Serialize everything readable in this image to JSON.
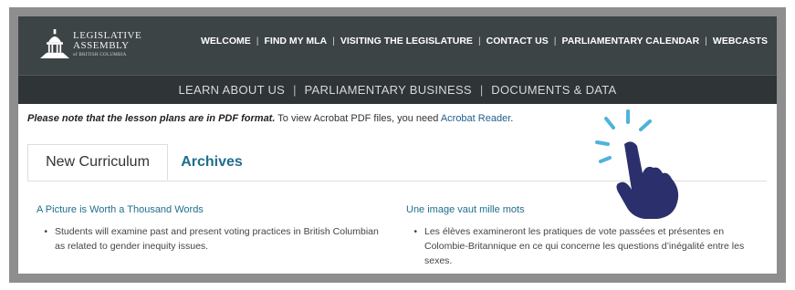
{
  "logo": {
    "name": "LEGISLATIVE ASSEMBLY",
    "sub": "of BRITISH COLUMBIA"
  },
  "top_nav": {
    "items": [
      "WELCOME",
      "FIND MY MLA",
      "VISITING THE LEGISLATURE",
      "CONTACT US",
      "PARLIAMENTARY CALENDAR",
      "WEBCASTS"
    ],
    "separator": "|"
  },
  "main_nav": {
    "items": [
      "LEARN ABOUT US",
      "PARLIAMENTARY BUSINESS",
      "DOCUMENTS & DATA"
    ],
    "separator": "|"
  },
  "notice": {
    "emphasis": "Please note that the lesson plans are in PDF format.",
    "text": " To view Acrobat PDF files, you need ",
    "link": "Acrobat Reader",
    "end": "."
  },
  "tabs": {
    "active": "New Curriculum",
    "inactive": "Archives"
  },
  "lessons": {
    "english": {
      "title": "A Picture is Worth a Thousand Words",
      "bullet": "Students will examine past and present voting practices in British Columbian as related to gender inequity issues."
    },
    "french": {
      "title": "Une image vaut mille mots",
      "bullet": "Les élèves examineront les pratiques de vote passées et présentes en Colombie-Britannique en ce qui concerne les questions d’inégalité entre les sexes."
    }
  },
  "colors": {
    "header_bg": "#3d4446",
    "mainnav_bg": "#2f3436",
    "link": "#1f6e8c",
    "frame": "#8e8e8e",
    "hand": "#2b2f6b",
    "accent": "#4fb3d9"
  },
  "icons": {
    "logo": "legislature-dome-icon",
    "pointer": "tap-hand-icon"
  }
}
